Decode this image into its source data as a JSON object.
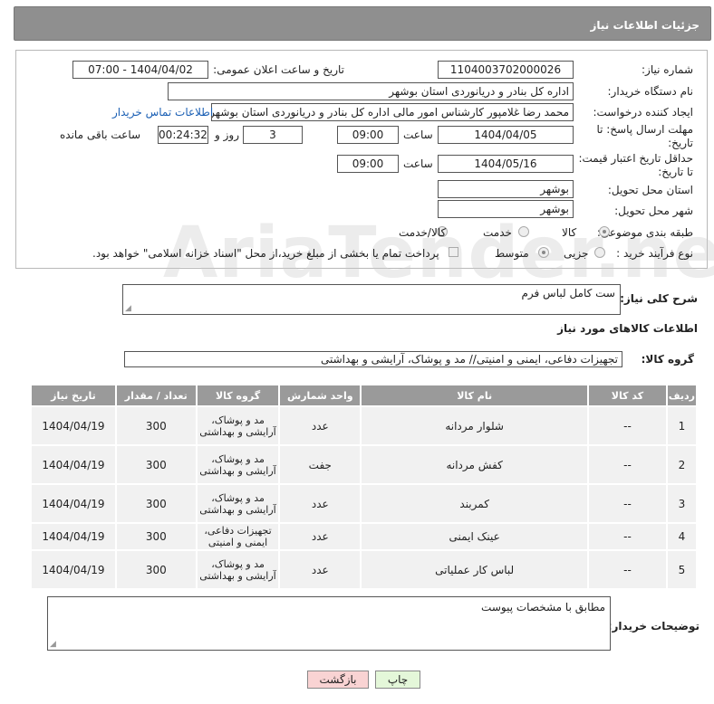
{
  "header": {
    "title": "جزئیات اطلاعات نیاز"
  },
  "form": {
    "need_number_label": "شماره نیاز:",
    "need_number": "1104003702000026",
    "announce_label": "تاریخ و ساعت اعلان عمومی:",
    "announce_value": "1404/04/02 - 07:00",
    "buyer_org_label": "نام دستگاه خریدار:",
    "buyer_org": "اداره کل بنادر و دریانوردی استان بوشهر",
    "creator_label": "ایجاد کننده درخواست:",
    "creator": "محمد رضا غلامپور کارشناس امور مالی اداره کل بنادر و دریانوردی استان بوشهر",
    "contact_link": "اطلاعات تماس خریدار",
    "reply_deadline_label": "مهلت ارسال پاسخ: تا تاریخ:",
    "reply_date": "1404/04/05",
    "time_label": "ساعت",
    "reply_time": "09:00",
    "days_value": "3",
    "days_label": "روز و",
    "remaining_time": "00:24:32",
    "remaining_label": "ساعت باقی مانده",
    "validity_label": "حداقل تاریخ اعتبار قیمت: تا تاریخ:",
    "validity_date": "1404/05/16",
    "validity_time": "09:00",
    "province_label": "استان محل تحویل:",
    "province": "بوشهر",
    "city_label": "شهر محل تحویل:",
    "city": "بوشهر",
    "category_label": "طبقه بندی موضوعی:",
    "category_options": [
      "کالا",
      "خدمت",
      "کالا/خدمت"
    ],
    "process_label": "نوع فرآیند خرید :",
    "process_options": [
      "جزیی",
      "متوسط"
    ],
    "payment_note": "پرداخت تمام یا بخشی از مبلغ خرید،از محل \"اسناد خزانه اسلامی\" خواهد بود."
  },
  "description": {
    "label": "شرح کلی نیاز:",
    "value": "ست کامل لباس فرم"
  },
  "goods_section": {
    "title": "اطلاعات کالاهای مورد نیاز",
    "group_label": "گروه کالا:",
    "group_value": "تجهیزات دفاعی، ایمنی و امنیتی// مد و پوشاک، آرایشی و بهداشتی"
  },
  "table": {
    "headers": [
      "ردیف",
      "کد کالا",
      "نام کالا",
      "واحد شمارش",
      "گروه کالا",
      "تعداد / مقدار",
      "تاریخ نیاز"
    ],
    "rows": [
      {
        "idx": "1",
        "code": "--",
        "name": "شلوار مردانه",
        "unit": "عدد",
        "group": "مد و پوشاک، آرایشی و بهداشتی",
        "qty": "300",
        "date": "1404/04/19"
      },
      {
        "idx": "2",
        "code": "--",
        "name": "کفش مردانه",
        "unit": "جفت",
        "group": "مد و پوشاک، آرایشی و بهداشتی",
        "qty": "300",
        "date": "1404/04/19"
      },
      {
        "idx": "3",
        "code": "--",
        "name": "کمربند",
        "unit": "عدد",
        "group": "مد و پوشاک، آرایشی و بهداشتی",
        "qty": "300",
        "date": "1404/04/19"
      },
      {
        "idx": "4",
        "code": "--",
        "name": "عینک ایمنی",
        "unit": "عدد",
        "group": "تجهیزات دفاعی، ایمنی و امنیتی",
        "qty": "300",
        "date": "1404/04/19"
      },
      {
        "idx": "5",
        "code": "--",
        "name": "لباس کار عملیاتی",
        "unit": "عدد",
        "group": "مد و پوشاک، آرایشی و بهداشتی",
        "qty": "300",
        "date": "1404/04/19"
      }
    ]
  },
  "buyer_notes": {
    "label": "توضیحات خریدار:",
    "value": "مطابق با مشخصات پیوست"
  },
  "buttons": {
    "print": "چاپ",
    "back": "بازگشت"
  },
  "colors": {
    "titlebar": "#8f8f8f",
    "table_header": "#9a9a9a",
    "link": "#1a5fb4",
    "back_button": "#f9d3d3",
    "print_button": "#e4f7d9"
  }
}
